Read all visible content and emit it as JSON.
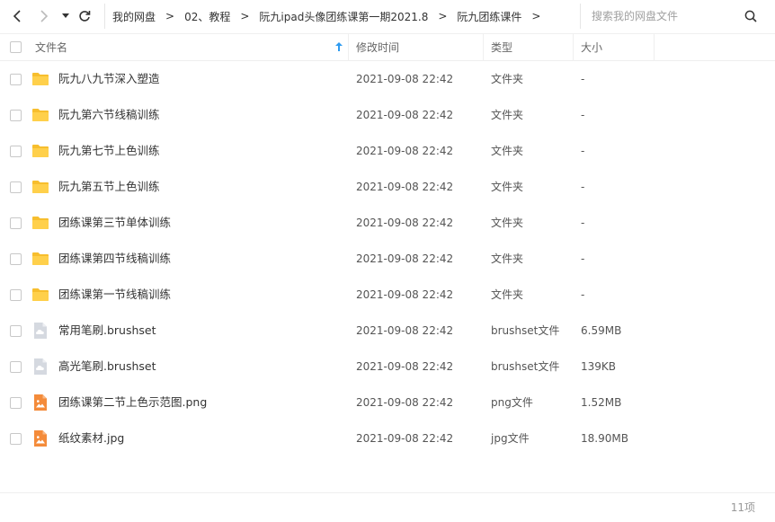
{
  "toolbar": {
    "back_icon": "chevron-left-icon",
    "forward_icon": "chevron-right-icon",
    "history_icon": "caret-down-icon",
    "refresh_icon": "refresh-icon"
  },
  "breadcrumb": {
    "items": [
      "我的网盘",
      "02、教程",
      "阮九ipad头像团练课第一期2021.8",
      "阮九团练课件"
    ],
    "separator": ">"
  },
  "search": {
    "placeholder": "搜索我的网盘文件",
    "value": ""
  },
  "columns": {
    "name": "文件名",
    "modified": "修改时间",
    "type": "类型",
    "size": "大小",
    "sort_icon": "arrow-up-icon"
  },
  "files": [
    {
      "name": "阮九八九节深入塑造",
      "modified": "2021-09-08 22:42",
      "type": "文件夹",
      "size": "-",
      "icon": "folder"
    },
    {
      "name": "阮九第六节线稿训练",
      "modified": "2021-09-08 22:42",
      "type": "文件夹",
      "size": "-",
      "icon": "folder"
    },
    {
      "name": "阮九第七节上色训练",
      "modified": "2021-09-08 22:42",
      "type": "文件夹",
      "size": "-",
      "icon": "folder"
    },
    {
      "name": "阮九第五节上色训练",
      "modified": "2021-09-08 22:42",
      "type": "文件夹",
      "size": "-",
      "icon": "folder"
    },
    {
      "name": "团练课第三节单体训练",
      "modified": "2021-09-08 22:42",
      "type": "文件夹",
      "size": "-",
      "icon": "folder"
    },
    {
      "name": "团练课第四节线稿训练",
      "modified": "2021-09-08 22:42",
      "type": "文件夹",
      "size": "-",
      "icon": "folder"
    },
    {
      "name": "团练课第一节线稿训练",
      "modified": "2021-09-08 22:42",
      "type": "文件夹",
      "size": "-",
      "icon": "folder"
    },
    {
      "name": "常用笔刷.brushset",
      "modified": "2021-09-08 22:42",
      "type": "brushset文件",
      "size": "6.59MB",
      "icon": "cloud-file"
    },
    {
      "name": "高光笔刷.brushset",
      "modified": "2021-09-08 22:42",
      "type": "brushset文件",
      "size": "139KB",
      "icon": "cloud-file"
    },
    {
      "name": "团练课第二节上色示范图.png",
      "modified": "2021-09-08 22:42",
      "type": "png文件",
      "size": "1.52MB",
      "icon": "image-file"
    },
    {
      "name": "纸纹素材.jpg",
      "modified": "2021-09-08 22:42",
      "type": "jpg文件",
      "size": "18.90MB",
      "icon": "image-file"
    }
  ],
  "footer": {
    "count": "11项"
  },
  "colors": {
    "folder": "#FFD04B",
    "folder_tab": "#F7BE2E",
    "cloud_file": "#D5D9E0",
    "image_file": "#F48B3A",
    "sort_arrow": "#2E9BF0"
  }
}
